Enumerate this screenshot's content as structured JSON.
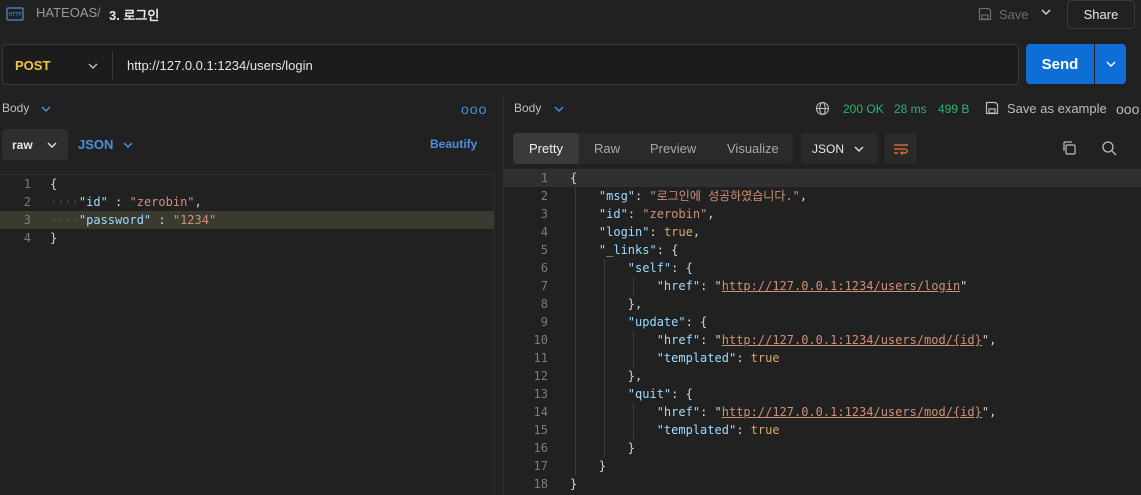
{
  "header": {
    "breadcrumb_parent": "HATEOAS",
    "breadcrumb_separator": "/",
    "breadcrumb_current": "3. 로그인",
    "save_label": "Save",
    "share_label": "Share"
  },
  "request": {
    "method": "POST",
    "url": "http://127.0.0.1:1234/users/login",
    "send_label": "Send"
  },
  "left_pane": {
    "section_label": "Body",
    "body_mode": "raw",
    "language": "JSON",
    "beautify_label": "Beautify",
    "more": "ooo",
    "lines": [
      {
        "n": "1",
        "parts": [
          {
            "t": "p",
            "v": "{"
          }
        ]
      },
      {
        "n": "2",
        "parts": [
          {
            "t": "dots",
            "v": "····"
          },
          {
            "t": "k",
            "v": "\"id\""
          },
          {
            "t": "p",
            "v": " : "
          },
          {
            "t": "s",
            "v": "\"zerobin\""
          },
          {
            "t": "p",
            "v": ","
          }
        ]
      },
      {
        "n": "3",
        "parts": [
          {
            "t": "dots",
            "v": "····"
          },
          {
            "t": "k",
            "v": "\"password\""
          },
          {
            "t": "p",
            "v": " : "
          },
          {
            "t": "s",
            "v": "\"1234\""
          }
        ]
      },
      {
        "n": "4",
        "parts": [
          {
            "t": "p",
            "v": "}"
          }
        ]
      }
    ]
  },
  "right_pane": {
    "section_label": "Body",
    "status": "200 OK",
    "time": "28 ms",
    "size": "499 B",
    "save_example_label": "Save as example",
    "more": "ooo",
    "tabs": [
      "Pretty",
      "Raw",
      "Preview",
      "Visualize"
    ],
    "format": "JSON",
    "lines": [
      {
        "n": "1",
        "parts": [
          {
            "t": "p",
            "v": "{"
          }
        ]
      },
      {
        "n": "2",
        "parts": [
          {
            "t": "p",
            "v": "    "
          },
          {
            "t": "k",
            "v": "\"msg\""
          },
          {
            "t": "p",
            "v": ": "
          },
          {
            "t": "s",
            "v": "\"로그인에 성공하였습니다.\""
          },
          {
            "t": "p",
            "v": ","
          }
        ]
      },
      {
        "n": "3",
        "parts": [
          {
            "t": "p",
            "v": "    "
          },
          {
            "t": "k",
            "v": "\"id\""
          },
          {
            "t": "p",
            "v": ": "
          },
          {
            "t": "s",
            "v": "\"zerobin\""
          },
          {
            "t": "p",
            "v": ","
          }
        ]
      },
      {
        "n": "4",
        "parts": [
          {
            "t": "p",
            "v": "    "
          },
          {
            "t": "k",
            "v": "\"login\""
          },
          {
            "t": "p",
            "v": ": "
          },
          {
            "t": "bool",
            "v": "true"
          },
          {
            "t": "p",
            "v": ","
          }
        ]
      },
      {
        "n": "5",
        "parts": [
          {
            "t": "p",
            "v": "    "
          },
          {
            "t": "k",
            "v": "\"_links\""
          },
          {
            "t": "p",
            "v": ": {"
          }
        ]
      },
      {
        "n": "6",
        "parts": [
          {
            "t": "p",
            "v": "        "
          },
          {
            "t": "k",
            "v": "\"self\""
          },
          {
            "t": "p",
            "v": ": {"
          }
        ]
      },
      {
        "n": "7",
        "parts": [
          {
            "t": "p",
            "v": "            "
          },
          {
            "t": "k",
            "v": "\"href\""
          },
          {
            "t": "p",
            "v": ": \""
          },
          {
            "t": "link",
            "v": "http://127.0.0.1:1234/users/login"
          },
          {
            "t": "p",
            "v": "\""
          }
        ]
      },
      {
        "n": "8",
        "parts": [
          {
            "t": "p",
            "v": "        },"
          }
        ]
      },
      {
        "n": "9",
        "parts": [
          {
            "t": "p",
            "v": "        "
          },
          {
            "t": "k",
            "v": "\"update\""
          },
          {
            "t": "p",
            "v": ": {"
          }
        ]
      },
      {
        "n": "10",
        "parts": [
          {
            "t": "p",
            "v": "            "
          },
          {
            "t": "k",
            "v": "\"href\""
          },
          {
            "t": "p",
            "v": ": \""
          },
          {
            "t": "link",
            "v": "http://127.0.0.1:1234/users/mod/{id}"
          },
          {
            "t": "p",
            "v": "\","
          }
        ]
      },
      {
        "n": "11",
        "parts": [
          {
            "t": "p",
            "v": "            "
          },
          {
            "t": "k",
            "v": "\"templated\""
          },
          {
            "t": "p",
            "v": ": "
          },
          {
            "t": "bool",
            "v": "true"
          }
        ]
      },
      {
        "n": "12",
        "parts": [
          {
            "t": "p",
            "v": "        },"
          }
        ]
      },
      {
        "n": "13",
        "parts": [
          {
            "t": "p",
            "v": "        "
          },
          {
            "t": "k",
            "v": "\"quit\""
          },
          {
            "t": "p",
            "v": ": {"
          }
        ]
      },
      {
        "n": "14",
        "parts": [
          {
            "t": "p",
            "v": "            "
          },
          {
            "t": "k",
            "v": "\"href\""
          },
          {
            "t": "p",
            "v": ": \""
          },
          {
            "t": "link",
            "v": "http://127.0.0.1:1234/users/mod/{id}"
          },
          {
            "t": "p",
            "v": "\","
          }
        ]
      },
      {
        "n": "15",
        "parts": [
          {
            "t": "p",
            "v": "            "
          },
          {
            "t": "k",
            "v": "\"templated\""
          },
          {
            "t": "p",
            "v": ": "
          },
          {
            "t": "bool",
            "v": "true"
          }
        ]
      },
      {
        "n": "16",
        "parts": [
          {
            "t": "p",
            "v": "        }"
          }
        ]
      },
      {
        "n": "17",
        "parts": [
          {
            "t": "p",
            "v": "    }"
          }
        ]
      },
      {
        "n": "18",
        "parts": [
          {
            "t": "p",
            "v": "}"
          }
        ]
      }
    ]
  },
  "colors": {
    "method": "#f5c242",
    "send": "#0f6dd6",
    "status_ok": "#2bb673",
    "link": "#4a90e2"
  }
}
